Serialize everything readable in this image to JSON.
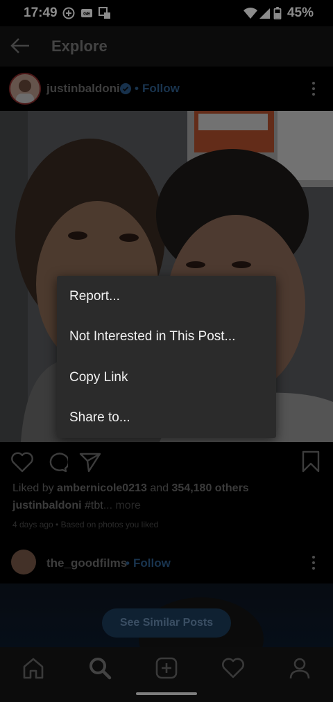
{
  "status_bar": {
    "time": "17:49",
    "battery": "45%"
  },
  "header": {
    "title": "Explore"
  },
  "post": {
    "username": "justinbaldoni",
    "follow_label": "Follow",
    "separator": "•",
    "likes_prefix": "Liked by",
    "liked_user": "ambernicole0213",
    "likes_and": "and",
    "likes_others": "354,180 others",
    "caption_user": "justinbaldoni",
    "caption_text": "#tbt",
    "caption_more": "... more",
    "meta": "4 days ago • Based on photos you liked"
  },
  "menu": {
    "items": [
      "Report...",
      "Not Interested in This Post...",
      "Copy Link",
      "Share to..."
    ]
  },
  "next_post": {
    "username": "the_goodfilms",
    "separator": "•",
    "follow_label": "Follow",
    "similar_button": "See Similar Posts"
  },
  "colors": {
    "accent": "#3897f0",
    "verified": "#3897f0",
    "menu_bg": "#2b2b2b"
  },
  "icons": {
    "back": "arrow-left-icon",
    "verified": "verified-badge-icon",
    "like": "heart-icon",
    "comment": "comment-icon",
    "share": "send-icon",
    "save": "bookmark-icon",
    "nav": [
      "home-icon",
      "search-icon",
      "add-post-icon",
      "activity-heart-icon",
      "profile-icon"
    ]
  }
}
